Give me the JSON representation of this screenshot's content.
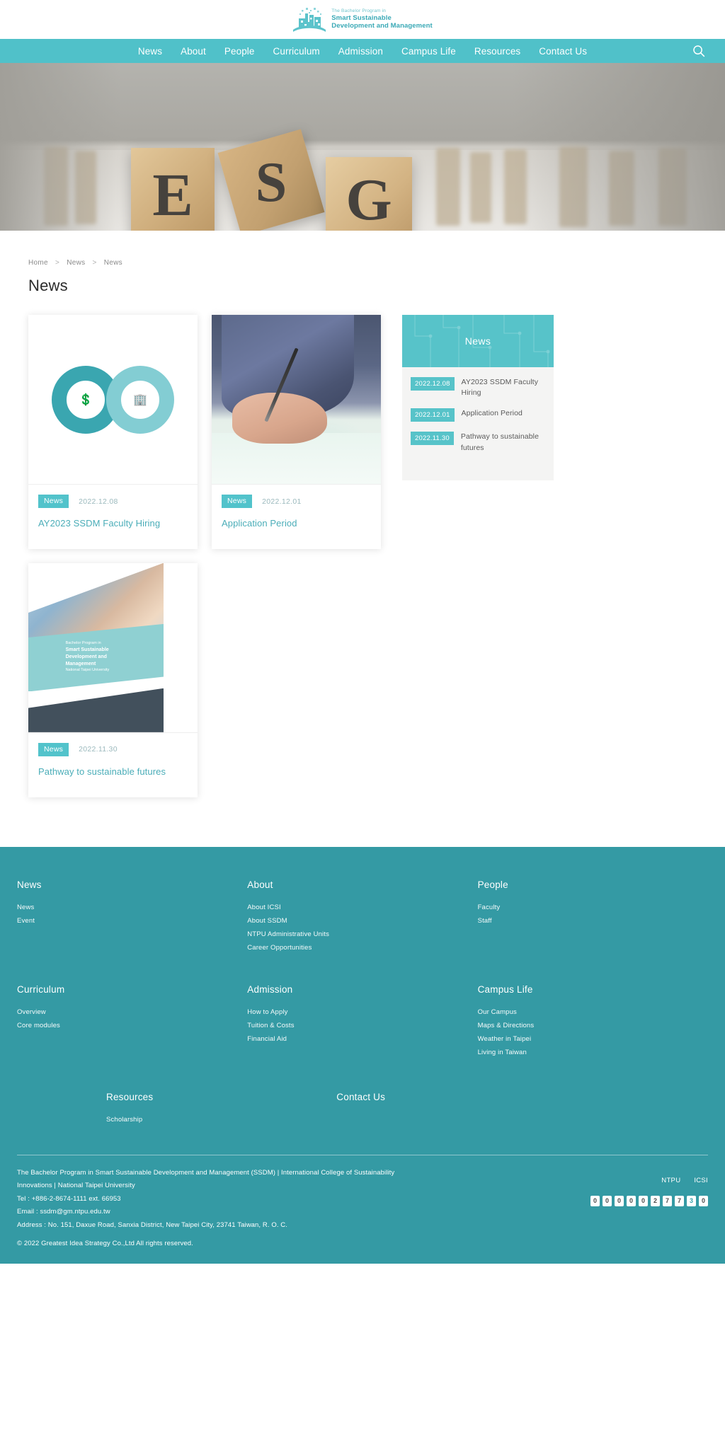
{
  "logo": {
    "line1": "The Bachelor Program in",
    "line2": "Smart Sustainable",
    "line3": "Development and Management",
    "icon": "ssdm-bridge-logo"
  },
  "nav": {
    "items": [
      {
        "label": "News"
      },
      {
        "label": "About"
      },
      {
        "label": "People"
      },
      {
        "label": "Curriculum"
      },
      {
        "label": "Admission"
      },
      {
        "label": "Campus Life"
      },
      {
        "label": "Resources"
      },
      {
        "label": "Contact Us"
      }
    ],
    "search_icon": "search-icon",
    "background": "#50c1c9"
  },
  "hero": {
    "letters": [
      "E",
      "S",
      "G"
    ],
    "alt": "ESG wooden blocks banner"
  },
  "breadcrumb": {
    "items": [
      "Home",
      "News",
      "News"
    ],
    "separator": ">"
  },
  "page": {
    "title": "News"
  },
  "cards": [
    {
      "badge": "News",
      "date": "2022.12.08",
      "title": "AY2023 SSDM Faculty Hiring",
      "thumb": "infinity-rings-graphic",
      "hub_left": "💲",
      "hub_right": "🏢"
    },
    {
      "badge": "News",
      "date": "2022.12.01",
      "title": "Application Period",
      "thumb": "hand-signing-document-photo"
    },
    {
      "badge": "News",
      "date": "2022.11.30",
      "title": "Pathway to sustainable futures",
      "thumb": "program-poster",
      "poster": {
        "l1": "Bachelor Program in",
        "l2": "Smart Sustainable",
        "l3": "Development and",
        "l4": "Management",
        "l5": "National Taipei University"
      }
    }
  ],
  "sidebar": {
    "title": "News",
    "items": [
      {
        "date": "2022.12.08",
        "title": "AY2023 SSDM Faculty Hiring"
      },
      {
        "date": "2022.12.01",
        "title": "Application Period"
      },
      {
        "date": "2022.11.30",
        "title": "Pathway to sustainable futures"
      }
    ]
  },
  "footer": {
    "columns": [
      {
        "heading": "News",
        "links": [
          "News",
          "Event"
        ]
      },
      {
        "heading": "About",
        "links": [
          "About ICSI",
          "About SSDM",
          "NTPU Administrative Units",
          "Career Opportunities"
        ]
      },
      {
        "heading": "People",
        "links": [
          "Faculty",
          "Staff"
        ]
      },
      {
        "heading": "Curriculum",
        "links": [
          "Overview",
          "Core modules"
        ]
      },
      {
        "heading": "Admission",
        "links": [
          "How to Apply",
          "Tuition & Costs",
          "Financial Aid"
        ]
      },
      {
        "heading": "Campus Life",
        "links": [
          "Our Campus",
          "Maps & Directions",
          "Weather in Taipei",
          "Living in Taiwan"
        ]
      },
      {
        "heading": "Resources",
        "links": [
          "Scholarship"
        ]
      },
      {
        "heading": "Contact Us",
        "links": []
      }
    ],
    "legal": {
      "line1": "The Bachelor Program in Smart Sustainable Development and Management (SSDM) | International College of Sustainability",
      "line2": "Innovations | National Taipei University",
      "line3": "Tel : +886-2-8674-1111 ext. 66953",
      "line4": "Email : ssdm@gm.ntpu.edu.tw",
      "line5": "Address : No. 151, Daxue Road, Sanxia District, New Taipei City, 23741 Taiwan, R. O. C.",
      "copyright": "© 2022 Greatest Idea Strategy Co.,Ltd All rights reserved."
    },
    "external_links": [
      "NTPU",
      "ICSI"
    ],
    "visitor_counter": [
      "0",
      "0",
      "0",
      "0",
      "0",
      "2",
      "7",
      "7",
      "3",
      "0"
    ],
    "counter_highlight_index": 8,
    "background": "#349aa4"
  }
}
